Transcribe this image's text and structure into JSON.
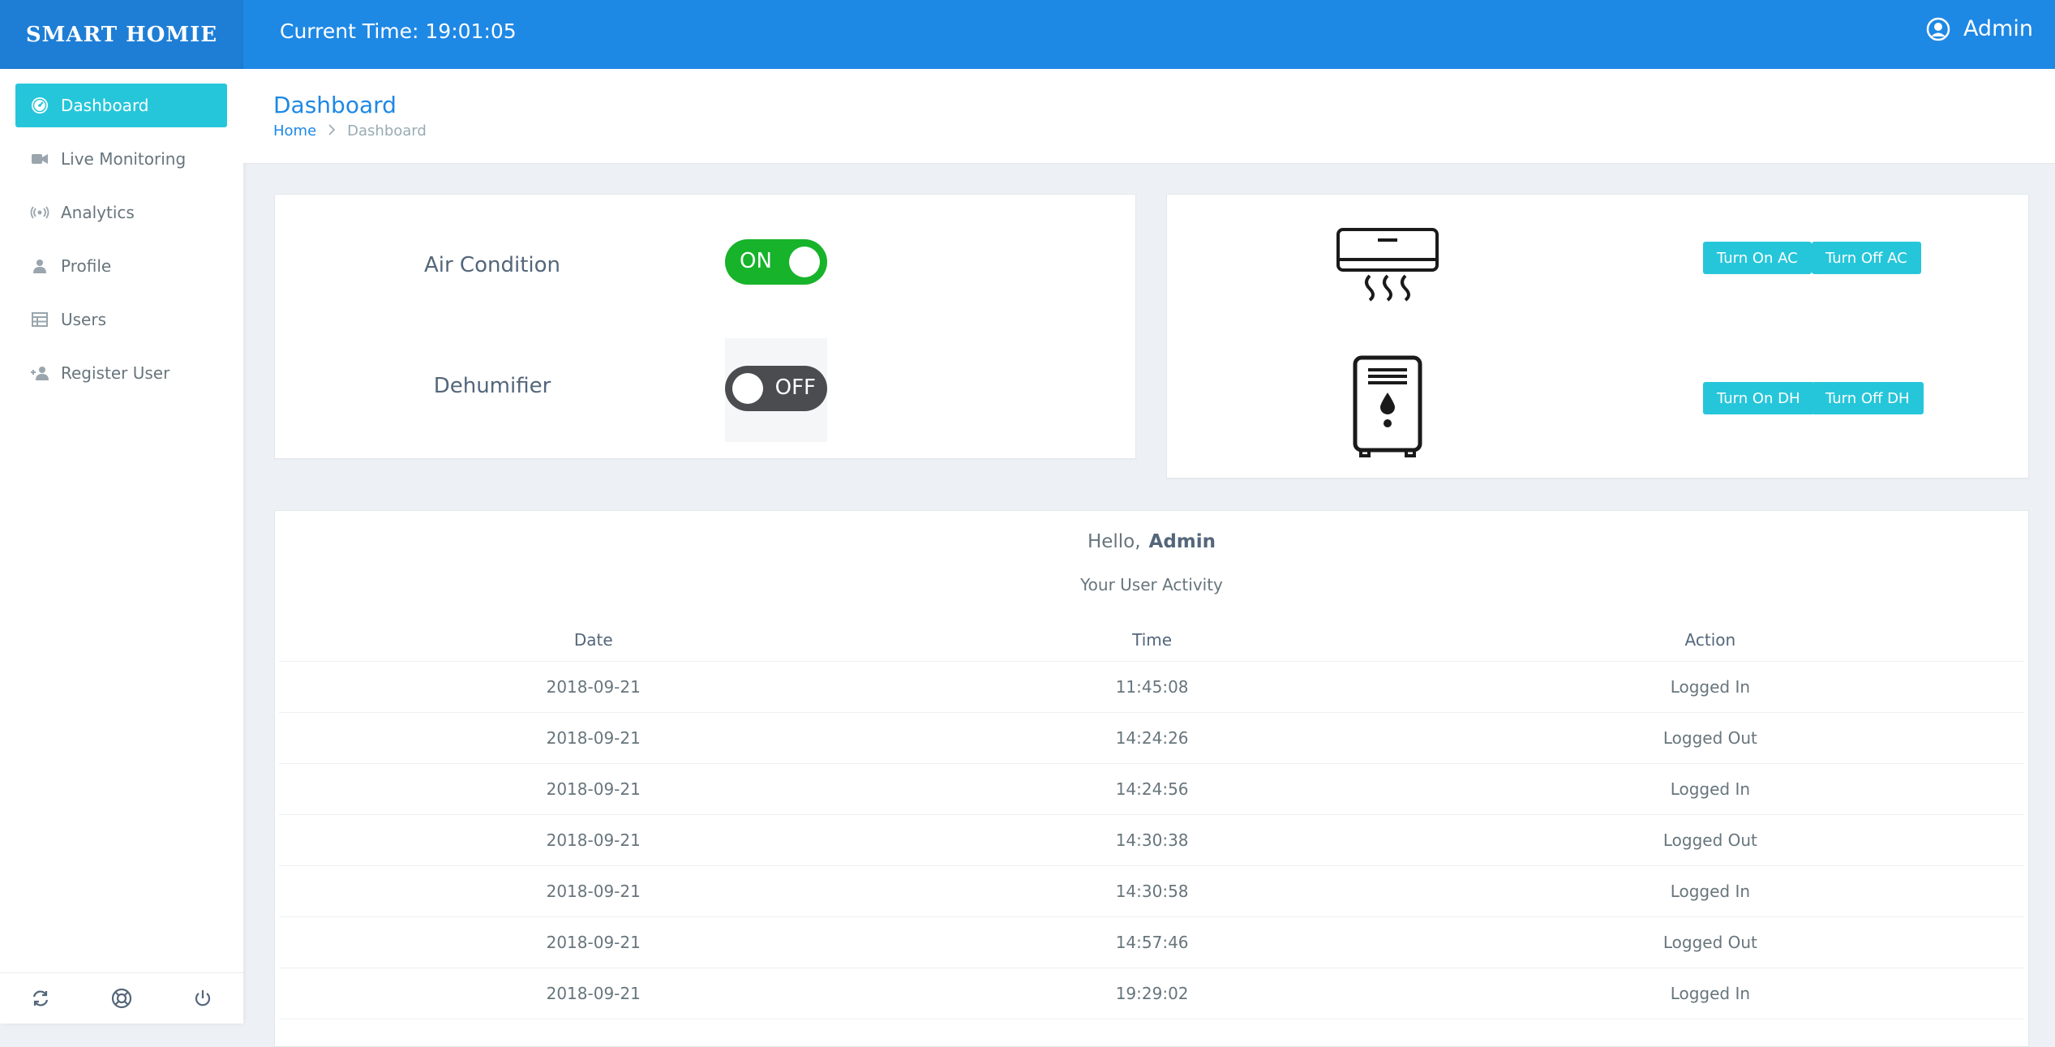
{
  "brand": "SMART HOMIE",
  "header": {
    "current_time": "Current Time: 19:01:05",
    "user_name": "Admin"
  },
  "sidebar": {
    "items": [
      {
        "label": "Dashboard",
        "icon": "speedometer-icon",
        "active": true
      },
      {
        "label": "Live Monitoring",
        "icon": "video-camera-icon"
      },
      {
        "label": "Analytics",
        "icon": "broadcast-icon"
      },
      {
        "label": "Profile",
        "icon": "person-icon"
      },
      {
        "label": "Users",
        "icon": "table-icon"
      },
      {
        "label": "Register User",
        "icon": "person-add-icon"
      }
    ],
    "footer_icons": [
      "refresh-icon",
      "lifebuoy-icon",
      "power-icon"
    ]
  },
  "page": {
    "title": "Dashboard",
    "breadcrumb": {
      "home": "Home",
      "current": "Dashboard"
    }
  },
  "toggles": [
    {
      "label": "Air Condition",
      "state": "ON"
    },
    {
      "label": "Dehumifier",
      "state": "OFF"
    }
  ],
  "devices": {
    "ac": {
      "icon": "air-conditioner-icon",
      "on_label": "Turn On AC",
      "off_label": "Turn Off AC"
    },
    "dh": {
      "icon": "dehumidifier-icon",
      "on_label": "Turn On DH",
      "off_label": "Turn Off DH"
    }
  },
  "activity": {
    "greeting": "Hello,",
    "user": "Admin",
    "subtitle": "Your User Activity",
    "columns": [
      "Date",
      "Time",
      "Action"
    ],
    "rows": [
      [
        "2018-09-21",
        "11:45:08",
        "Logged In"
      ],
      [
        "2018-09-21",
        "14:24:26",
        "Logged Out"
      ],
      [
        "2018-09-21",
        "14:24:56",
        "Logged In"
      ],
      [
        "2018-09-21",
        "14:30:38",
        "Logged Out"
      ],
      [
        "2018-09-21",
        "14:30:58",
        "Logged In"
      ],
      [
        "2018-09-21",
        "14:57:46",
        "Logged Out"
      ],
      [
        "2018-09-21",
        "19:29:02",
        "Logged In"
      ]
    ]
  },
  "colors": {
    "primary": "#1e88e5",
    "info": "#26c6da",
    "toggle_on": "#17b32a",
    "toggle_off": "#4b4c4f"
  }
}
